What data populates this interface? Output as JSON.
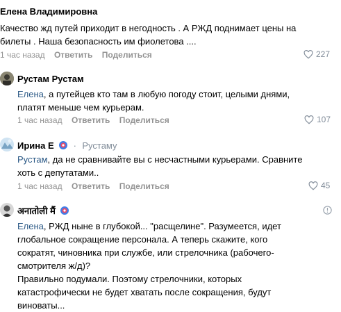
{
  "comments": [
    {
      "author": "Елена Владимировна",
      "text": "Качество жд путей приходит в негодность . А РЖД поднимает цены на билеты . Наша безопасность им фиолетова ....",
      "line1": "Качество жд путей приходит в негодность . А РЖД поднимает цены на",
      "line2": "билеты . Наша безопасность им фиолетова ....",
      "time": "1 час назад",
      "reply_label": "Ответить",
      "share_label": "Поделиться",
      "likes": "227"
    },
    {
      "author": "Рустам Рустам",
      "mention": "Елена",
      "line1": ", а путейцев кто там в любую погоду стоит, целыми днями,",
      "line2": "платят меньше чем курьерам.",
      "time": "1 час назад",
      "reply_label": "Ответить",
      "share_label": "Поделиться",
      "likes": "107"
    },
    {
      "author": "Ирина Е",
      "reply_to": "Рустаму",
      "reply_sep": "·",
      "mention": "Рустам",
      "line1": ", да не сравнивайте вы с несчастными курьерами. Сравните",
      "line2": "хоть с депутатами..",
      "time": "1 час назад",
      "reply_label": "Ответить",
      "share_label": "Поделиться",
      "likes": "45"
    },
    {
      "author": "अनातोली मैं",
      "mention": "Елена",
      "line1": ", РЖД ныне в глубокой... \"расщелине\". Разумеется, идет",
      "line2": "глобальное сокращение персонала. А теперь скажите, кого",
      "line3": "сократят, чиновника при службе, или стрелочника (рабочего-",
      "line4": "смотрителя ж/д)?",
      "line5": "Правильно подумали. Поэтому стрелочники, которых",
      "line6": "катастрофически не будет хватать после сокращения, будут",
      "line7": "виноваты..."
    }
  ],
  "icons": {
    "like": "heart-outline-icon",
    "badge": "colorful-badge-icon",
    "info": "info-icon"
  }
}
